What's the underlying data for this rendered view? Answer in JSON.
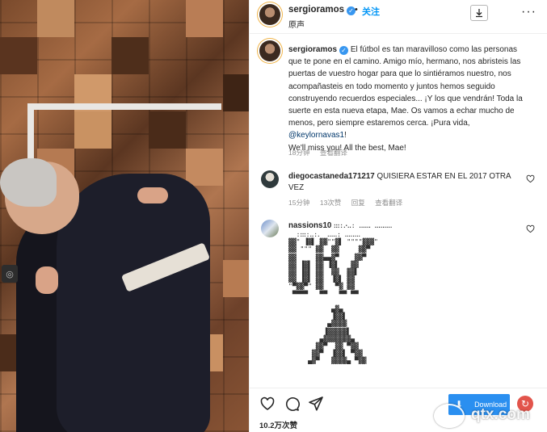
{
  "post": {
    "username": "sergioramos",
    "follow_label": "关注",
    "subtitle": "原声",
    "more_label": "···"
  },
  "caption": {
    "username": "sergioramos",
    "text": "El fútbol es tan maravilloso como las personas que te pone en el camino. Amigo mío, hermano, nos abristeis las puertas de vuestro hogar para que lo sintiéramos nuestro, nos acompañasteis en todo momento y juntos hemos seguido construyendo recuerdos especiales... ¡Y los que vendrán! Toda la suerte en esta nueva etapa, Mae. Os vamos a echar mucho de menos, pero siempre estaremos cerca. ¡Pura vida,",
    "mention": "@keylornavas1",
    "mention_suffix": "!",
    "english": "We'll miss you! All the best, Mae!",
    "time": "18分钟",
    "translate": "查看翻译"
  },
  "comments": [
    {
      "username": "diegocastaneda171217",
      "text": "QUISIERA ESTAR EN EL 2017 OTRA VEZ",
      "time": "15分钟",
      "likes": "13次赞",
      "reply": "回复",
      "translate": "查看翻译"
    },
    {
      "username": "nassions10",
      "text": "ꓽꓽꓽ꞉ꓸꞏꓸꓸ꞉ ꓸꓸꓸꓸꓸꓸ ꓸꓸꓸꓸꓸꓸꓸꓸꓸ",
      "ascii_art": "  ꞉ꓽꓽꓽ꞉ꓸꓸ꞉ꓸ  ꓸꓸꓸꓸꓸ꞉ ꓸꓸꓸꓸꓸꓸꓸꓸ\n▓▓\" ▐▓▌ ▓▓\"\"▓▌ \"\"\"\"▓▓▓\"\n▓▓ \"\"\" ▓▓  ▓▓     ▓▓▀\n▓▓     ▓▓▄▄▓▀    ▓▓▀\n▓▓ ▐▓▌ ▓▓ ▐▓▌   ▓▓\n▓▓ ▐▓▌ ▓▓  ▓▓  ▓▓▌\n▓▓ ▐▓▌ ▓▓  ▐▓▌ ▓▓\n\"▀▓▓▀\" ▓▓   ▀▓ ▓▓\n ▀▀▀▀   ▀▀   ▀▀ ▀▀\n\n           ▄▓▄\n           ▐▓▓▌\n          ▄▓▓▓▓\n         ▐▓▓▓▓▓▌\n        ▄▓▓▓▓▓▓▓▄\n       ▓▓▀  ▓▓ ▀▓▓\n      ▓▓▀  ▐▓▓▌ ▀▓▓\n     ▄▓▀   ▓▓▓▓▄ ▀▓▓"
    }
  ],
  "footer": {
    "likes": "10.2万次赞",
    "download_label": "Download",
    "watermark": "qtx.com"
  },
  "colors": {
    "accent": "#0095f6",
    "verified": "#3897f0",
    "download": "#2a8ff0",
    "reload": "#e2544b"
  },
  "icons": [
    "heart-icon",
    "comment-icon",
    "share-icon",
    "download-icon",
    "more-icon",
    "verified-icon",
    "reload-icon"
  ]
}
